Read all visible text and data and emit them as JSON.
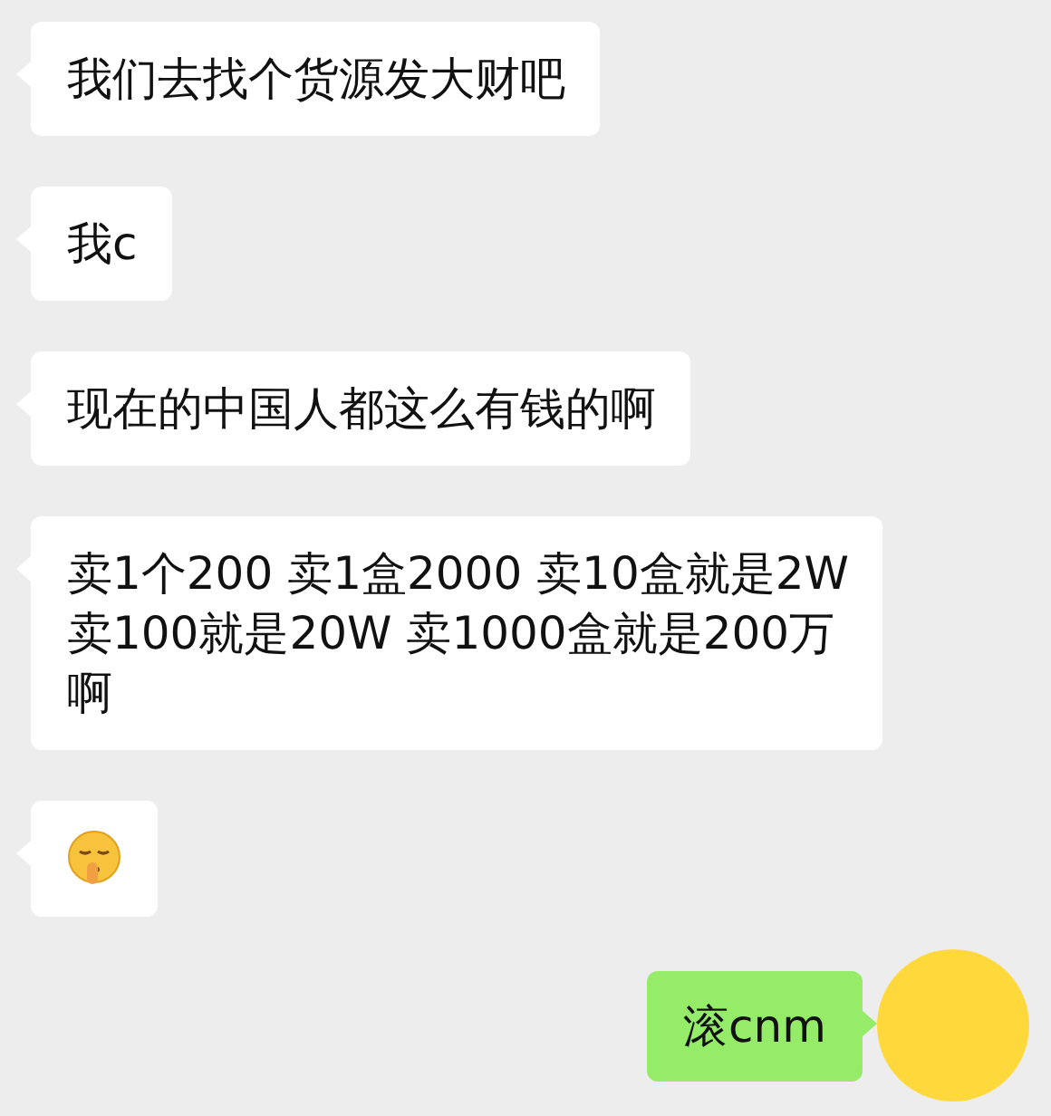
{
  "messages": [
    {
      "outgoing": false,
      "kind": "text",
      "lines": [
        "我们去找个货源发大财吧"
      ]
    },
    {
      "outgoing": false,
      "kind": "text",
      "lines": [
        "我c"
      ]
    },
    {
      "outgoing": false,
      "kind": "text",
      "lines": [
        "现在的中国人都这么有钱的啊"
      ]
    },
    {
      "outgoing": false,
      "kind": "text",
      "lines": [
        "卖1个200 卖1盒2000 卖10盒就是2W",
        "卖100就是20W 卖1000盒就是200万",
        "啊"
      ]
    },
    {
      "outgoing": false,
      "kind": "emoji"
    },
    {
      "outgoing": true,
      "kind": "text",
      "lines": [
        "滚cnm"
      ]
    }
  ]
}
